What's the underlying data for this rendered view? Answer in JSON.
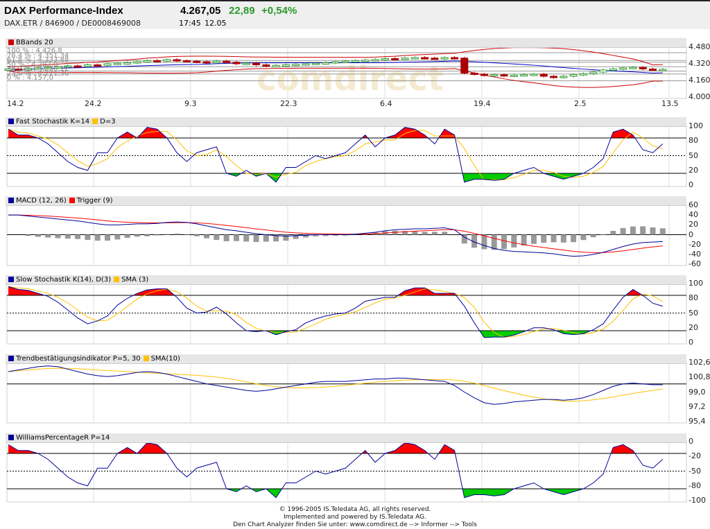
{
  "header": {
    "title": "DAX Performance-Index",
    "identifiers": "DAX.ETR  /  846900  /  DE0008469008",
    "price": "4.267,05",
    "change": "22,89",
    "change_pct": "+0,54%",
    "time": "17:45",
    "date": "12.05"
  },
  "colors": {
    "up": "#2a9a2a",
    "down": "#cc0000",
    "blue": "#000099",
    "orange": "#ffc000",
    "red": "#ff0000"
  },
  "footer": {
    "line1": "© 1996-2005 IS.Teledata AG, all rights reserved.",
    "line2": "Implemented and powered by IS.Teledata AG.",
    "line3": "Den Chart Analyzer finden Sie unter: www.comdirect.de --> Informer --> Tools"
  },
  "chart_data": [
    {
      "type": "candlestick",
      "title": "BBands 20",
      "watermark": "comdirect",
      "x_labels": [
        "14.2",
        "24.2",
        "9.3",
        "22.3",
        "6.4",
        "19.4",
        "2.5",
        "13.5"
      ],
      "y_ticks": [
        "4.480",
        "4.320",
        "4.160",
        "4.000"
      ],
      "ylim": [
        4000,
        4480
      ],
      "fib_labels": [
        "100 % : 4.426,8",
        "76,4 % : 4.351,34",
        "61,8 % : 4.333,88",
        "50 % : 4.292,0",
        "38,2 % : 4.250,12",
        "23,6 % : 4.221,36",
        "0 % : 4.157,0"
      ],
      "fib_levels": [
        4426.8,
        4351.34,
        4333.88,
        4292.0,
        4250.12,
        4221.36,
        4157.0
      ],
      "close": [
        4270,
        4260,
        4275,
        4280,
        4285,
        4290,
        4300,
        4295,
        4310,
        4305,
        4320,
        4325,
        4330,
        4340,
        4350,
        4345,
        4360,
        4350,
        4345,
        4340,
        4330,
        4345,
        4335,
        4320,
        4325,
        4310,
        4300,
        4305,
        4310,
        4315,
        4320,
        4325,
        4330,
        4340,
        4345,
        4350,
        4355,
        4360,
        4370,
        4365,
        4375,
        4380,
        4375,
        4370,
        4380,
        4375,
        4230,
        4220,
        4210,
        4215,
        4205,
        4210,
        4215,
        4220,
        4200,
        4190,
        4200,
        4215,
        4225,
        4240,
        4260,
        4270,
        4280,
        4285,
        4270,
        4265,
        4267
      ]
    },
    {
      "type": "line",
      "title": "Fast Stochastik K=14",
      "legend2": "D=3",
      "y_ticks": [
        "100",
        "80",
        "50",
        "20",
        "0"
      ],
      "ylim": [
        0,
        100
      ],
      "bands": [
        20,
        80
      ],
      "k": [
        95,
        85,
        85,
        80,
        70,
        55,
        40,
        30,
        25,
        55,
        55,
        80,
        90,
        80,
        98,
        95,
        80,
        55,
        40,
        55,
        60,
        65,
        20,
        15,
        25,
        15,
        20,
        5,
        30,
        30,
        40,
        50,
        45,
        50,
        55,
        70,
        85,
        65,
        80,
        85,
        98,
        95,
        85,
        70,
        95,
        85,
        5,
        10,
        10,
        8,
        10,
        20,
        25,
        30,
        20,
        15,
        10,
        15,
        20,
        30,
        45,
        90,
        95,
        85,
        60,
        55,
        70
      ]
    },
    {
      "type": "line",
      "title": "MACD (12, 26)",
      "legend2": "Trigger (9)",
      "y_ticks": [
        "60",
        "40",
        "20",
        "0",
        "-20",
        "-40",
        "-60"
      ],
      "ylim": [
        -60,
        60
      ],
      "macd": [
        40,
        40,
        38,
        36,
        34,
        32,
        30,
        28,
        25,
        22,
        20,
        20,
        21,
        22,
        22,
        23,
        25,
        26,
        25,
        22,
        18,
        14,
        10,
        8,
        5,
        2,
        0,
        -2,
        -3,
        -2,
        -1,
        0,
        0,
        0,
        0,
        1,
        3,
        5,
        8,
        10,
        11,
        12,
        12,
        13,
        14,
        10,
        -5,
        -15,
        -22,
        -28,
        -32,
        -34,
        -35,
        -36,
        -37,
        -39,
        -42,
        -44,
        -43,
        -40,
        -36,
        -30,
        -24,
        -19,
        -16,
        -15,
        -14
      ]
    },
    {
      "type": "line",
      "title": "Slow Stochastik K(14), D(3)",
      "legend2": "SMA (3)",
      "y_ticks": [
        "100",
        "80",
        "50",
        "20",
        "0"
      ],
      "ylim": [
        0,
        100
      ],
      "bands": [
        20,
        80
      ]
    },
    {
      "type": "line",
      "title": "Trendbestätigungsindikator P=5, 30",
      "legend2": "SMA(10)",
      "y_ticks": [
        "102,6",
        "100,8",
        "99,0",
        "97,2",
        "95,4"
      ],
      "ylim": [
        95.4,
        102.6
      ],
      "ref": 100,
      "values": [
        101.5,
        101.7,
        101.9,
        102.1,
        102.2,
        102.1,
        101.8,
        101.5,
        101.2,
        101.0,
        100.9,
        101.0,
        101.2,
        101.4,
        101.5,
        101.4,
        101.2,
        100.9,
        100.6,
        100.3,
        100.0,
        99.8,
        99.6,
        99.4,
        99.2,
        99.1,
        99.2,
        99.4,
        99.6,
        99.8,
        100.0,
        100.2,
        100.3,
        100.3,
        100.3,
        100.4,
        100.5,
        100.6,
        100.6,
        100.7,
        100.7,
        100.6,
        100.5,
        100.4,
        100.3,
        99.8,
        99.0,
        98.3,
        97.7,
        97.5,
        97.6,
        97.8,
        97.9,
        98.0,
        98.1,
        98.1,
        98.0,
        98.1,
        98.3,
        98.7,
        99.2,
        99.7,
        100.0,
        100.1,
        100.0,
        99.9,
        99.9
      ]
    },
    {
      "type": "line",
      "title": "WilliamsPercentageR P=14",
      "y_ticks": [
        "0",
        "-20",
        "-50",
        "-80",
        "-100"
      ],
      "ylim": [
        -100,
        0
      ],
      "bands": [
        -80,
        -20
      ]
    }
  ]
}
